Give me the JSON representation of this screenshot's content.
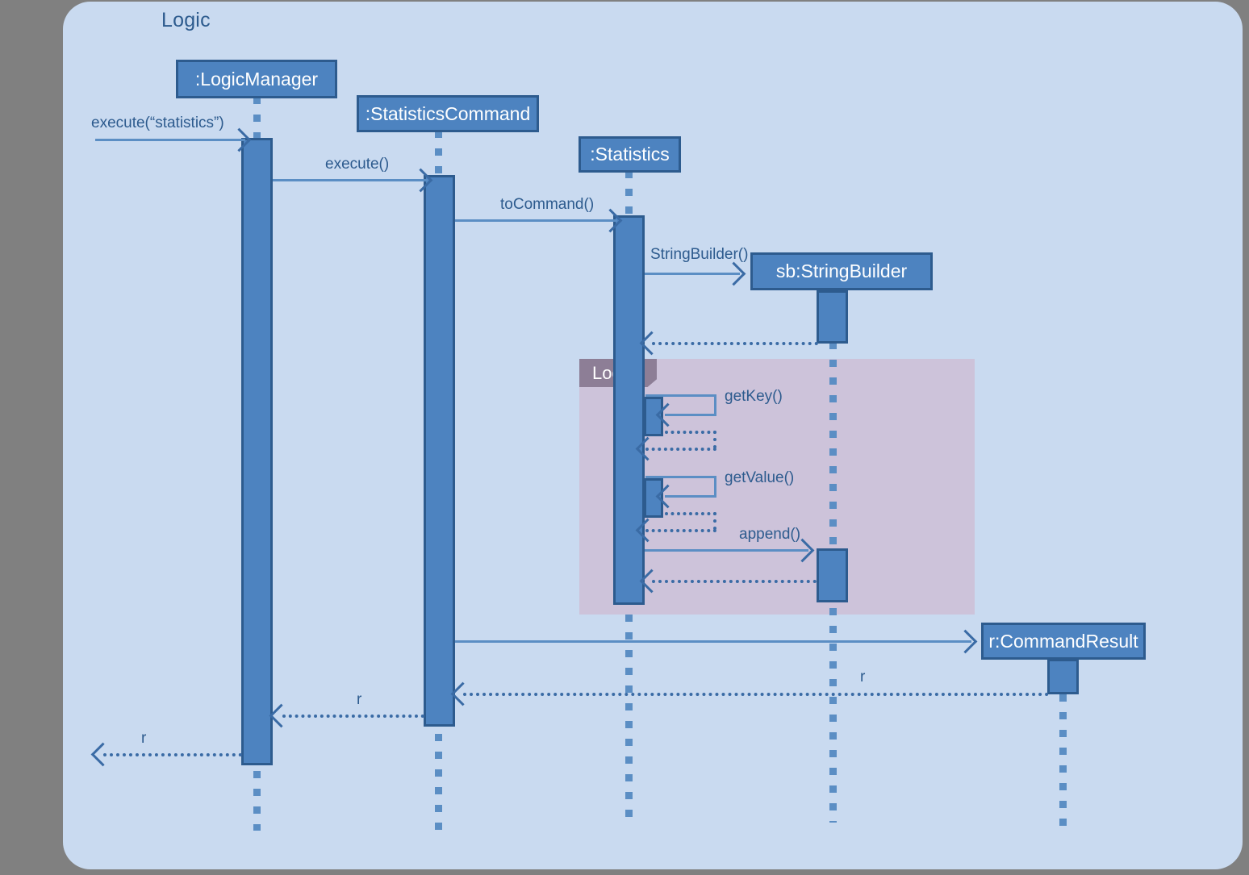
{
  "diagram": {
    "title": "Logic",
    "type": "uml-sequence-diagram",
    "colors": {
      "background": "#808080",
      "frame": "#c9daf0",
      "actor_fill": "#4d83c0",
      "actor_border": "#2d5b8e",
      "fragment_fill": "#cdc3da",
      "fragment_label_fill": "#8d7e96",
      "line": "#5b8ec4",
      "text": "#2d5b8e"
    }
  },
  "participants": [
    {
      "id": "logicmanager",
      "label": ":LogicManager"
    },
    {
      "id": "statisticscommand",
      "label": ":StatisticsCommand"
    },
    {
      "id": "statistics",
      "label": ":Statistics"
    },
    {
      "id": "stringbuilder",
      "label": "sb:StringBuilder"
    },
    {
      "id": "commandresult",
      "label": "r:CommandResult"
    }
  ],
  "fragments": [
    {
      "id": "loop",
      "label": "Loop",
      "kind": "loop"
    }
  ],
  "messages": [
    {
      "id": "m1",
      "label": "execute(“statistics”)",
      "from": "external",
      "to": "logicmanager",
      "kind": "call"
    },
    {
      "id": "m2",
      "label": "execute()",
      "from": "logicmanager",
      "to": "statisticscommand",
      "kind": "call"
    },
    {
      "id": "m3",
      "label": "toCommand()",
      "from": "statisticscommand",
      "to": "statistics",
      "kind": "call"
    },
    {
      "id": "m4",
      "label": "StringBuilder()",
      "from": "statistics",
      "to": "stringbuilder",
      "kind": "create"
    },
    {
      "id": "m5",
      "label": "",
      "from": "stringbuilder",
      "to": "statistics",
      "kind": "return"
    },
    {
      "id": "m6",
      "label": "getKey()",
      "from": "statistics",
      "to": "statistics",
      "kind": "self-call"
    },
    {
      "id": "m7",
      "label": "",
      "from": "statistics",
      "to": "statistics",
      "kind": "self-return"
    },
    {
      "id": "m8",
      "label": "getValue()",
      "from": "statistics",
      "to": "statistics",
      "kind": "self-call"
    },
    {
      "id": "m9",
      "label": "",
      "from": "statistics",
      "to": "statistics",
      "kind": "self-return"
    },
    {
      "id": "m10",
      "label": "append()",
      "from": "statistics",
      "to": "stringbuilder",
      "kind": "call"
    },
    {
      "id": "m11",
      "label": "",
      "from": "stringbuilder",
      "to": "statistics",
      "kind": "return"
    },
    {
      "id": "m12",
      "label": "",
      "from": "statisticscommand",
      "to": "commandresult",
      "kind": "create"
    },
    {
      "id": "m13",
      "label": "r",
      "from": "commandresult",
      "to": "statisticscommand",
      "kind": "return"
    },
    {
      "id": "m14",
      "label": "r",
      "from": "statisticscommand",
      "to": "logicmanager",
      "kind": "return"
    },
    {
      "id": "m15",
      "label": "r",
      "from": "logicmanager",
      "to": "external",
      "kind": "return"
    }
  ]
}
